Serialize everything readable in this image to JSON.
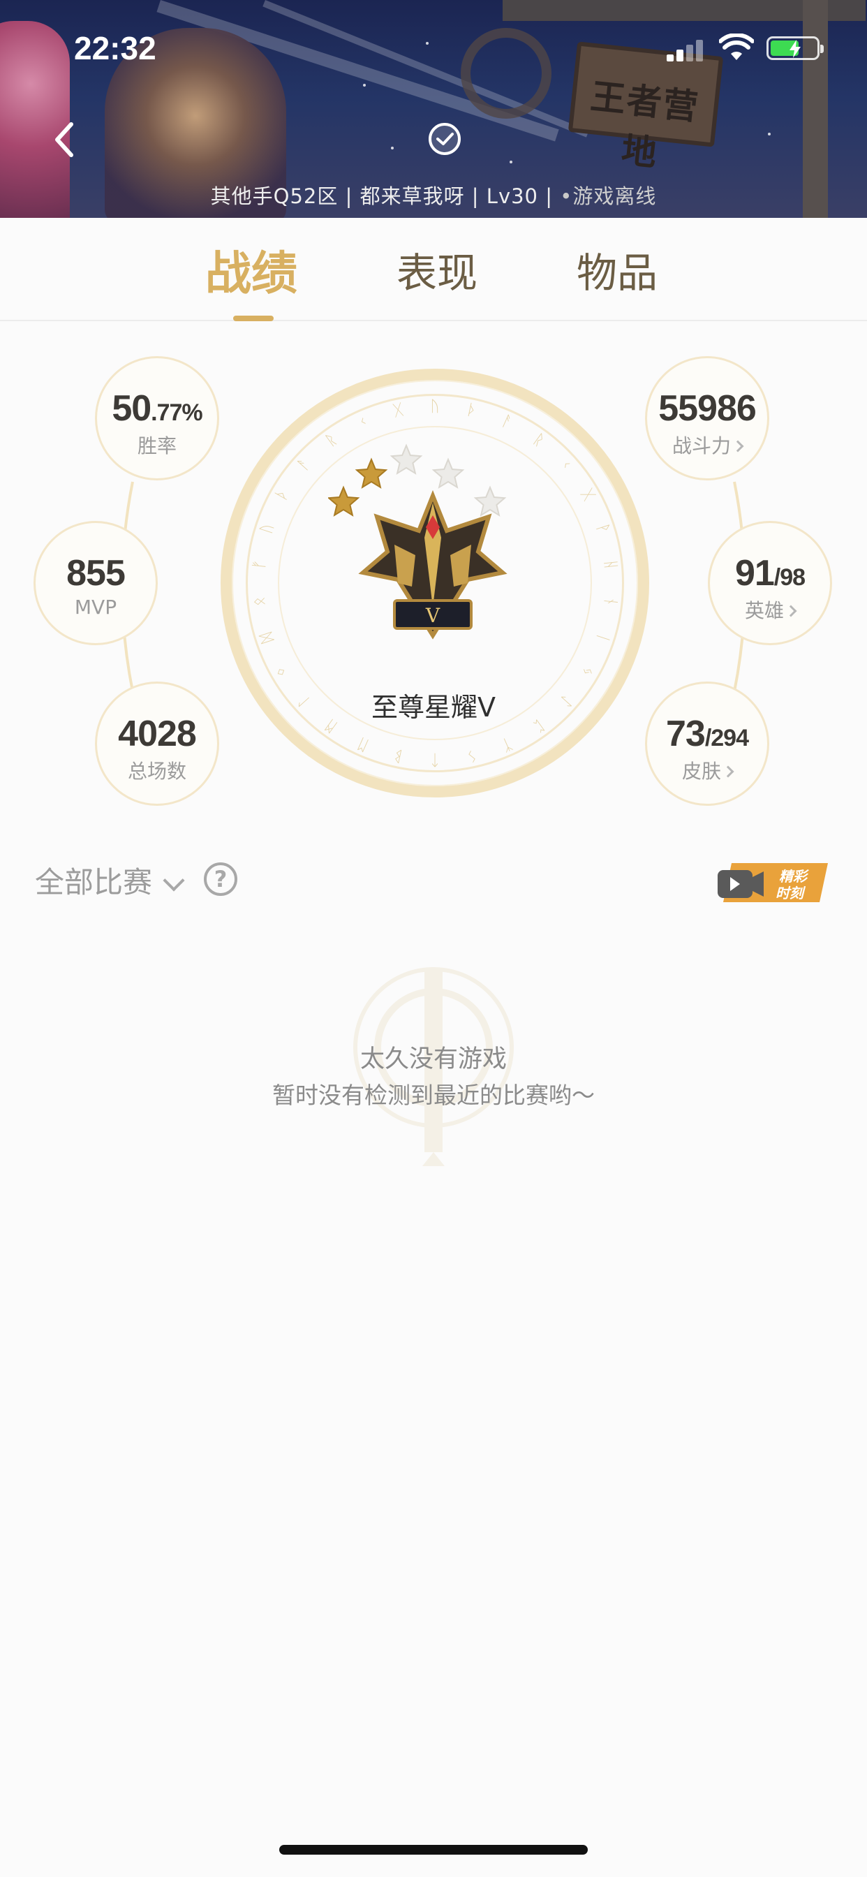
{
  "status_bar": {
    "time": "22:32",
    "battery_color": "#3ddb52"
  },
  "header": {
    "profile_info": "其他手Q52区 | 都来草我呀 | Lv30 | ",
    "online_status": "游戏离线",
    "sign_text": "王者营地"
  },
  "tabs": [
    {
      "label": "战绩",
      "active": true
    },
    {
      "label": "表现",
      "active": false
    },
    {
      "label": "物品",
      "active": false
    }
  ],
  "stats": {
    "win_rate": {
      "value_main": "50",
      "value_decimal": ".77%",
      "label": "胜率"
    },
    "mvp": {
      "value": "855",
      "label": "MVP"
    },
    "total_games": {
      "value": "4028",
      "label": "总场数"
    },
    "combat_power": {
      "value": "55986",
      "label": "战斗力"
    },
    "heroes": {
      "value": "91",
      "total": "/98",
      "label": "英雄"
    },
    "skins": {
      "value": "73",
      "total": "/294",
      "label": "皮肤"
    }
  },
  "rank": {
    "name": "至尊星耀Ⅴ",
    "stars_filled": 2,
    "stars_total": 5,
    "tier_numeral": "V"
  },
  "filter": {
    "label": "全部比赛",
    "help": "?"
  },
  "highlight": {
    "line1": "精彩",
    "line2": "时刻"
  },
  "empty_state": {
    "title": "太久没有游戏",
    "subtitle": "暂时没有检测到最近的比赛哟～"
  },
  "colors": {
    "accent": "#d8b061",
    "ring": "#f2e3bf",
    "tab_inactive": "#6b5d44",
    "highlight_orange": "#e9a23b"
  }
}
